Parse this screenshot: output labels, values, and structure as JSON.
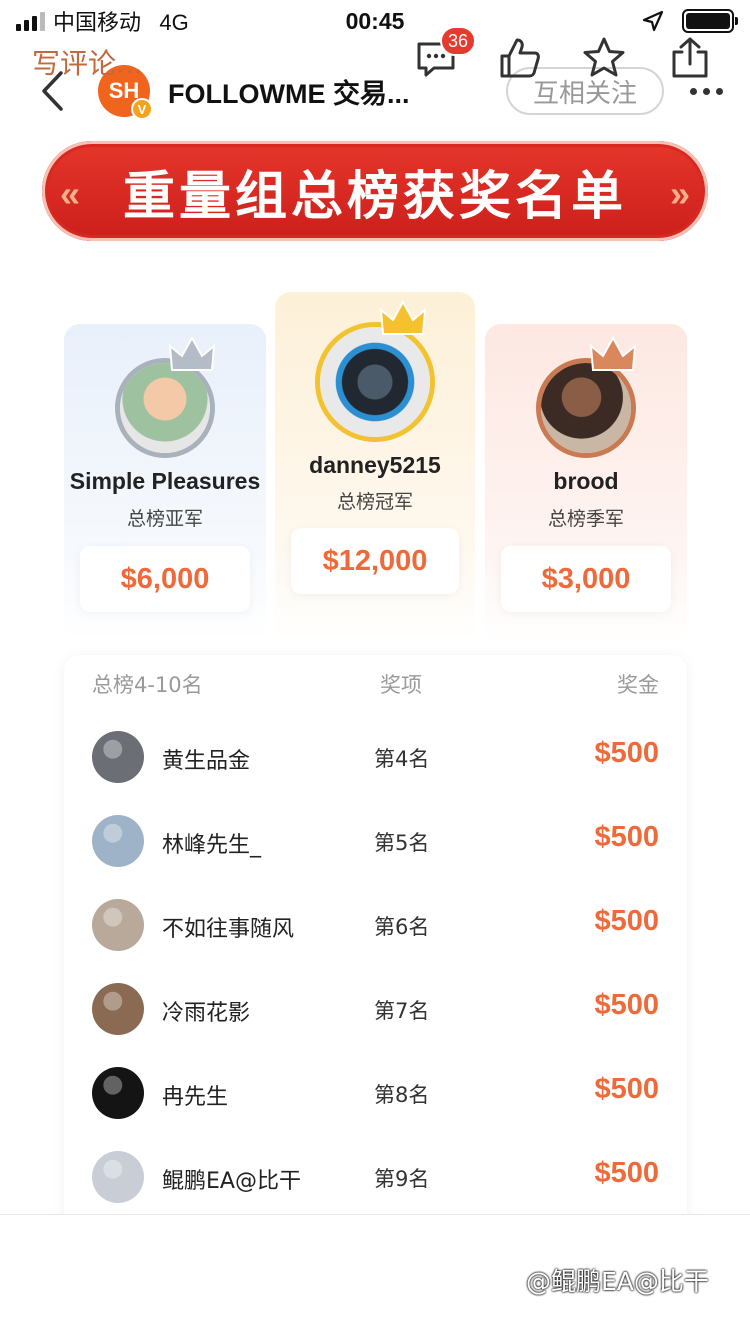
{
  "status_bar": {
    "carrier": "中国移动",
    "network": "4G",
    "time": "00:45",
    "battery_level": 1.0
  },
  "nav": {
    "logo_text": "SH",
    "logo_badge": "V",
    "title": "FOLLOWME 交易...",
    "follow_label": "互相关注"
  },
  "banner": {
    "title": "重量组总榜获奖名单",
    "deco_left": "«",
    "deco_right": "»"
  },
  "podium": {
    "second": {
      "name": "Simple Pleasures",
      "rank": "总榜亚军",
      "prize": "$6,000",
      "crown_color": "#b4bcc8"
    },
    "first": {
      "name": "danney5215",
      "rank": "总榜冠军",
      "prize": "$12,000",
      "crown_color": "#f5c12e"
    },
    "third": {
      "name": "brood",
      "rank": "总榜季军",
      "prize": "$3,000",
      "crown_color": "#d9875c"
    }
  },
  "table": {
    "header": {
      "rank_range": "总榜4-10名",
      "award": "奖项",
      "prize": "奖金"
    },
    "rows": [
      {
        "name": "黄生品金",
        "rank": "第4名",
        "prize": "$500",
        "avatar_color": "#6b6f75"
      },
      {
        "name": "林峰先生_",
        "rank": "第5名",
        "prize": "$500",
        "avatar_color": "#9fb3c8"
      },
      {
        "name": "不如往事随风",
        "rank": "第6名",
        "prize": "$500",
        "avatar_color": "#b9a99a"
      },
      {
        "name": "冷雨花影",
        "rank": "第7名",
        "prize": "$500",
        "avatar_color": "#8a6a52"
      },
      {
        "name": "冉先生",
        "rank": "第8名",
        "prize": "$500",
        "avatar_color": "#141414"
      },
      {
        "name": "鲲鹏EA@比干",
        "rank": "第9名",
        "prize": "$500",
        "avatar_color": "#c9ced6"
      }
    ]
  },
  "bottom_bar": {
    "comment_placeholder": "写评论...",
    "comment_count": "36",
    "watermark": "@鲲鹏EA@比干"
  },
  "colors": {
    "accent_orange": "#ee6a3a",
    "banner_red": "#d8281f"
  },
  "icons": [
    "back-icon",
    "more-icon",
    "crown-icon",
    "comment-icon",
    "like-icon",
    "star-icon",
    "share-icon",
    "location-arrow-icon",
    "battery-icon",
    "signal-icon"
  ]
}
